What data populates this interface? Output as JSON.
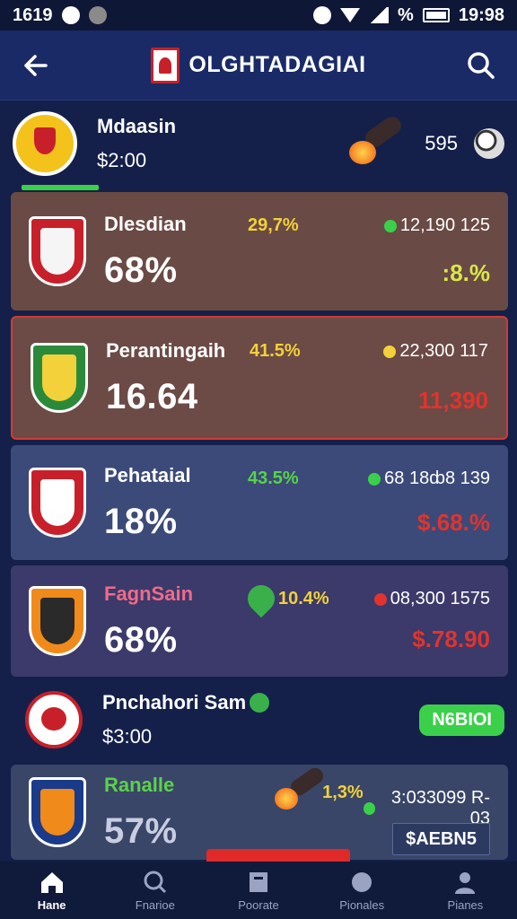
{
  "status_bar": {
    "time": "1619",
    "clock": "19:98",
    "battery_symbol": "%"
  },
  "header": {
    "title": "OLGHTADAGIAI"
  },
  "summary": {
    "name": "Mdaasin",
    "price": "$2:00",
    "value": "595"
  },
  "cards": [
    {
      "team": "Dlesdian",
      "big": "68%",
      "change": "29,7%",
      "top_right": "12,190  125",
      "bottom_right": ":8.%"
    },
    {
      "team": "Perantingaih",
      "big": "16.64",
      "change": "41.5%",
      "top_right": "22,300  117",
      "bottom_right": "11,390"
    },
    {
      "team": "Pehataial",
      "big": "18%",
      "change": "43.5%",
      "top_right": "68 18ȸ8  139",
      "bottom_right": "$.68.%"
    },
    {
      "team": "FagnSain",
      "big": "68%",
      "change": "10.4%",
      "top_right": "08,300  1575",
      "bottom_right": "$.78.90"
    }
  ],
  "row2": {
    "name": "Pnchahori Sam",
    "price": "$3:00",
    "cta": "N6BIOI"
  },
  "last_card": {
    "team": "Ranalle",
    "big": "57%",
    "change": "1,3%",
    "top_right": "3:033099  R-03",
    "box": "$AEBN5"
  },
  "bottom_nav": [
    {
      "label": "Hane"
    },
    {
      "label": "Fnarioe"
    },
    {
      "label": "Poorate"
    },
    {
      "label": "Pionales"
    },
    {
      "label": "Pianes"
    }
  ],
  "colors": {
    "accent_green": "#3bd04a",
    "accent_red": "#e0342e",
    "accent_yellow": "#f2d13a"
  }
}
